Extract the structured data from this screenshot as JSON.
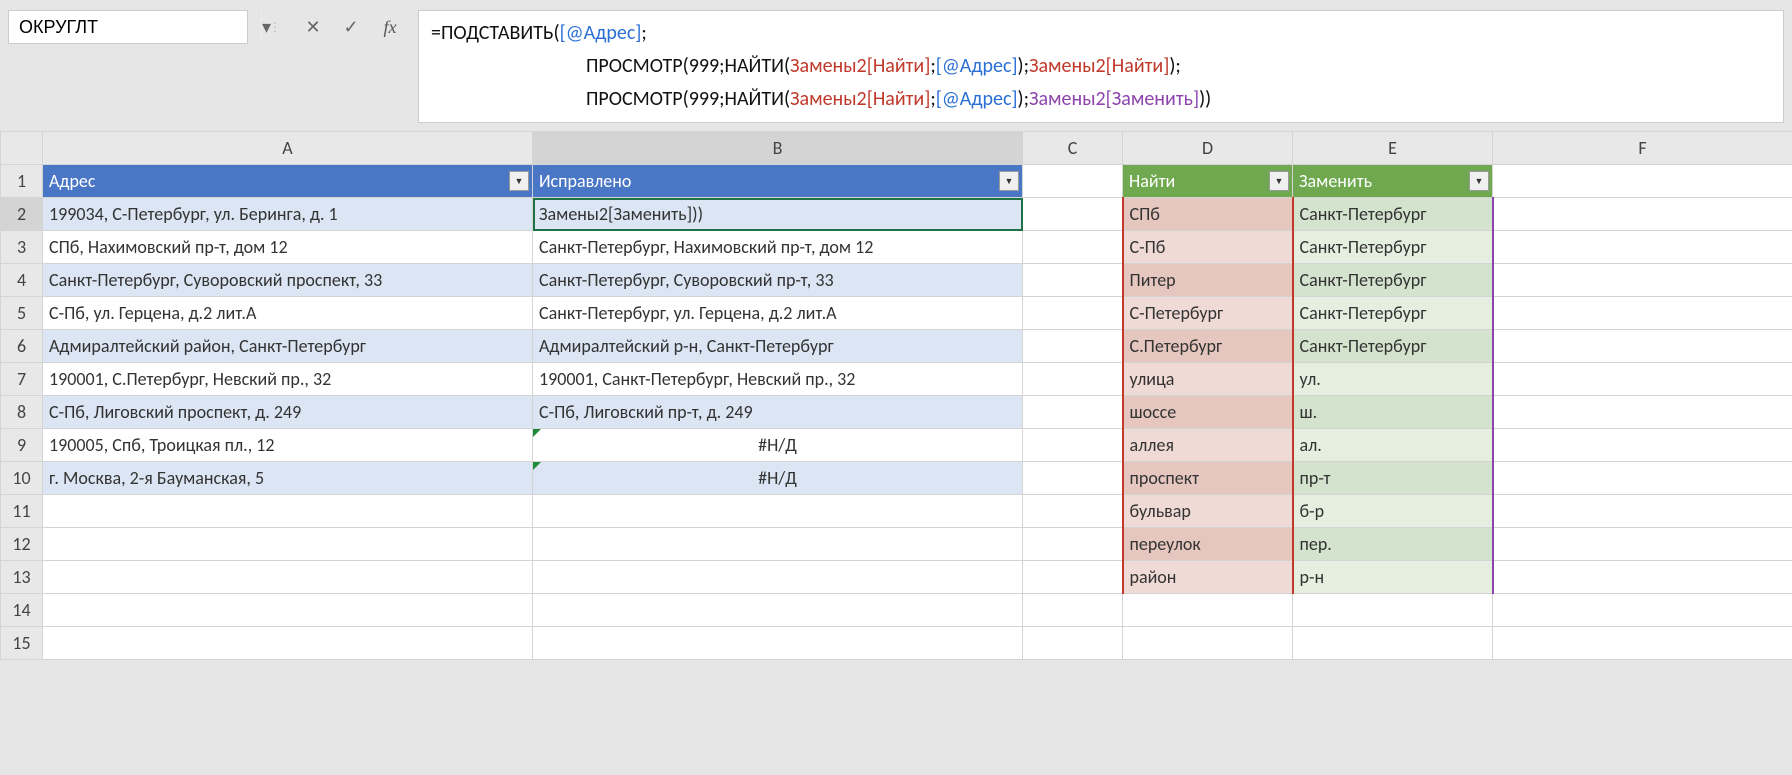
{
  "name_box": "ОКРУГЛТ",
  "fx_label": "fx",
  "formula_parts": {
    "eq": "=",
    "fn_sub": "ПОДСТАВИТЬ",
    "op": "(",
    "ref_addr": "[@Адрес]",
    "semi": ";",
    "cp": ")",
    "fn_look": "ПРОСМОТР",
    "num": "999",
    "fn_find": "НАЙТИ",
    "ref_find": "Замены2[Найти]",
    "ref_repl": "Замены2[Заменить]"
  },
  "columns": [
    "A",
    "B",
    "C",
    "D",
    "E",
    "F"
  ],
  "table1": {
    "headers": [
      "Адрес",
      "Исправлено"
    ],
    "rows": [
      [
        "199034, С-Петербург, ул. Беринга, д. 1",
        "Замены2[Заменить]))"
      ],
      [
        "СПб, Нахимовский пр-т, дом 12",
        "Санкт-Петербург, Нахимовский пр-т, дом 12"
      ],
      [
        "Санкт-Петербург, Суворовский проспект, 33",
        "Санкт-Петербург, Суворовский пр-т, 33"
      ],
      [
        "С-Пб, ул. Герцена, д.2 лит.А",
        "Санкт-Петербург, ул. Герцена, д.2 лит.А"
      ],
      [
        "Адмиралтейский район, Санкт-Петербург",
        "Адмиралтейский р-н, Санкт-Петербург"
      ],
      [
        "190001, С.Петербург, Невский пр., 32",
        "190001, Санкт-Петербург, Невский пр., 32"
      ],
      [
        "С-Пб, Лиговский проспект, д. 249",
        "С-Пб, Лиговский пр-т, д. 249"
      ],
      [
        "190005, Спб, Троицкая пл., 12",
        "#Н/Д"
      ],
      [
        "г. Москва, 2-я Бауманская, 5",
        "#Н/Д"
      ]
    ]
  },
  "table2": {
    "headers": [
      "Найти",
      "Заменить"
    ],
    "rows": [
      [
        "СПб",
        "Санкт-Петербург"
      ],
      [
        "С-Пб",
        "Санкт-Петербург"
      ],
      [
        "Питер",
        "Санкт-Петербург"
      ],
      [
        "С-Петербург",
        "Санкт-Петербург"
      ],
      [
        "С.Петербург",
        "Санкт-Петербург"
      ],
      [
        "улица",
        "ул."
      ],
      [
        "шоссе",
        "ш."
      ],
      [
        "аллея",
        "ал."
      ],
      [
        "проспект",
        "пр-т"
      ],
      [
        "бульвар",
        "б-р"
      ],
      [
        "переулок",
        "пер."
      ],
      [
        "район",
        "р-н"
      ]
    ]
  },
  "row_count": 15,
  "icons": {
    "dd": "▾",
    "cancel": "✕",
    "enter": "✓",
    "sep": "⋮"
  }
}
